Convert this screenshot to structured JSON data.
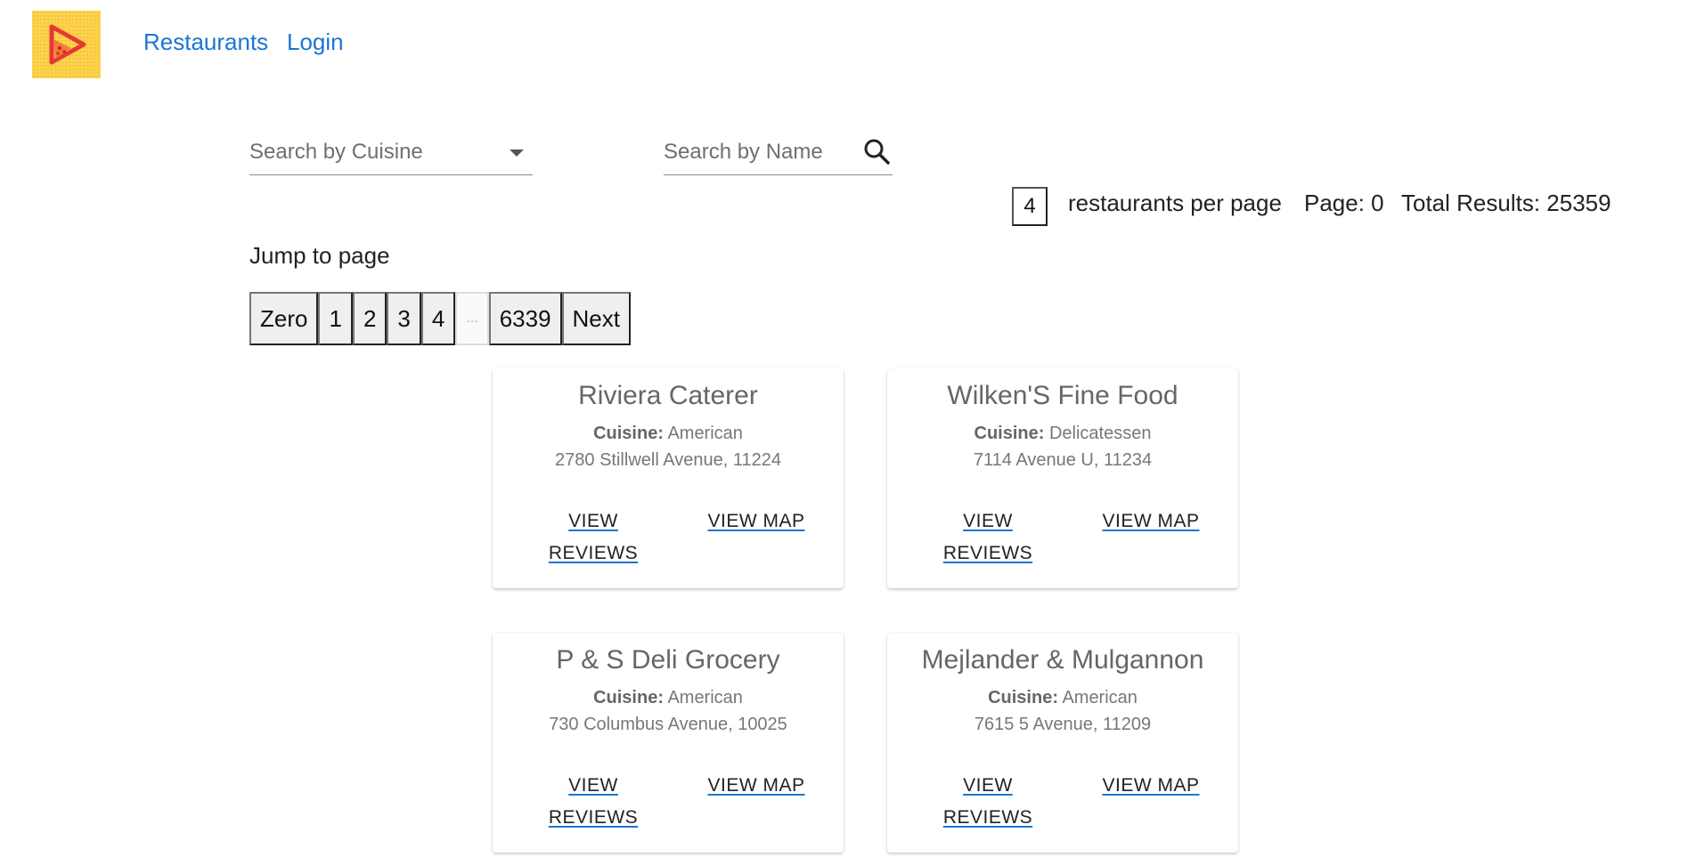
{
  "header": {
    "logo_icon": "food-play-logo-icon",
    "nav": {
      "restaurants": "Restaurants",
      "login": "Login"
    }
  },
  "filters": {
    "cuisine_placeholder": "Search by Cuisine",
    "name_placeholder": "Search by Name"
  },
  "paging": {
    "per_page_value": "4",
    "per_page_label": "restaurants per page",
    "page_label": "Page: 0",
    "total_label": "Total Results: 25359",
    "jump_label": "Jump to page",
    "buttons": [
      "Zero",
      "1",
      "2",
      "3",
      "4",
      "...",
      "6339",
      "Next"
    ]
  },
  "restaurants": [
    {
      "name": "Riviera Caterer",
      "cuisine_label": "Cuisine:",
      "cuisine": "American",
      "address": "2780 Stillwell Avenue, 11224",
      "reviews_line1": "VIEW",
      "reviews_line2": "REVIEWS",
      "map_label": "VIEW MAP"
    },
    {
      "name": "Wilken'S Fine Food",
      "cuisine_label": "Cuisine:",
      "cuisine": "Delicatessen",
      "address": "7114 Avenue U, 11234",
      "reviews_line1": "VIEW",
      "reviews_line2": "REVIEWS",
      "map_label": "VIEW MAP"
    },
    {
      "name": "P & S Deli Grocery",
      "cuisine_label": "Cuisine:",
      "cuisine": "American",
      "address": "730 Columbus Avenue, 10025",
      "reviews_line1": "VIEW",
      "reviews_line2": "REVIEWS",
      "map_label": "VIEW MAP"
    },
    {
      "name": "Mejlander & Mulgannon",
      "cuisine_label": "Cuisine:",
      "cuisine": "American",
      "address": "7615 5 Avenue, 11209",
      "reviews_line1": "VIEW",
      "reviews_line2": "REVIEWS",
      "map_label": "VIEW MAP"
    }
  ],
  "colors": {
    "link": "#1976d2",
    "logo_bg": "#fcd34d",
    "logo_accent": "#e53935"
  }
}
